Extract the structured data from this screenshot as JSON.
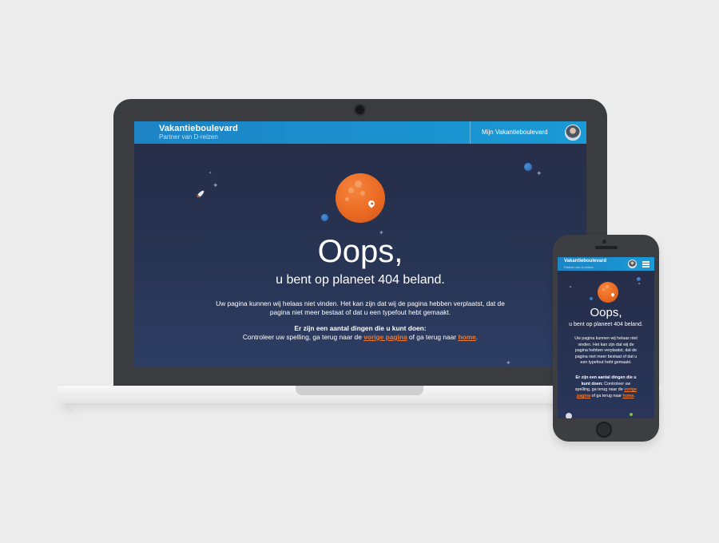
{
  "site": {
    "brand": "Vakantieboulevard",
    "tagline": "Partner van D-reizen",
    "account_label": "Mijn Vakantieboulevard"
  },
  "error": {
    "headline": "Oops,",
    "subheadline": "u bent op planeet 404 beland.",
    "body_line1": "Uw pagina kunnen wij helaas niet vinden. Het kan zijn dat wij de pagina hebben verplaatst, dat de",
    "body_line2": "pagina niet meer bestaat of dat u een typefout hebt gemaakt.",
    "options_heading": "Er zijn een aantal dingen die u kunt doen:",
    "options_prefix": "Controleer uw spelling, ga terug naar de",
    "options_middle": "of ga terug naar",
    "options_suffix": ".",
    "link_previous": "vorige pagina",
    "link_home": "home"
  },
  "mobile": {
    "headline": "Oops,",
    "subheadline": "u bent op planeet 404 beland.",
    "body_lines": [
      "Uw pagina kunnen wij helaas niet",
      "vinden. Het kan zijn dat wij de",
      "pagina hebben verplaatst, dat de",
      "pagina niet meer bestaat of dat u",
      "een typefout hebt gemaakt."
    ],
    "options_heading_1": "Er zijn een aantal dingen die u",
    "options_heading_2": "kunt doen:",
    "options_rest_1": "Controleer uw",
    "options_line2": "spelling, ga terug naar de",
    "link_previous_1": "vorige",
    "link_previous_2": "pagina",
    "options_middle": "of ga terug naar",
    "link_home": "home",
    "options_suffix": "."
  },
  "colors": {
    "header_blue": "#1d8ecf",
    "background_navy": "#252c47",
    "planet_orange": "#ea6a23",
    "link_orange": "#f07a2e",
    "device_dark": "#3a3c3f"
  },
  "icons": [
    "rocket-icon",
    "planet-icon",
    "location-pin-icon",
    "moon-icon",
    "star-icon",
    "avatar-icon",
    "hamburger-menu-icon"
  ]
}
